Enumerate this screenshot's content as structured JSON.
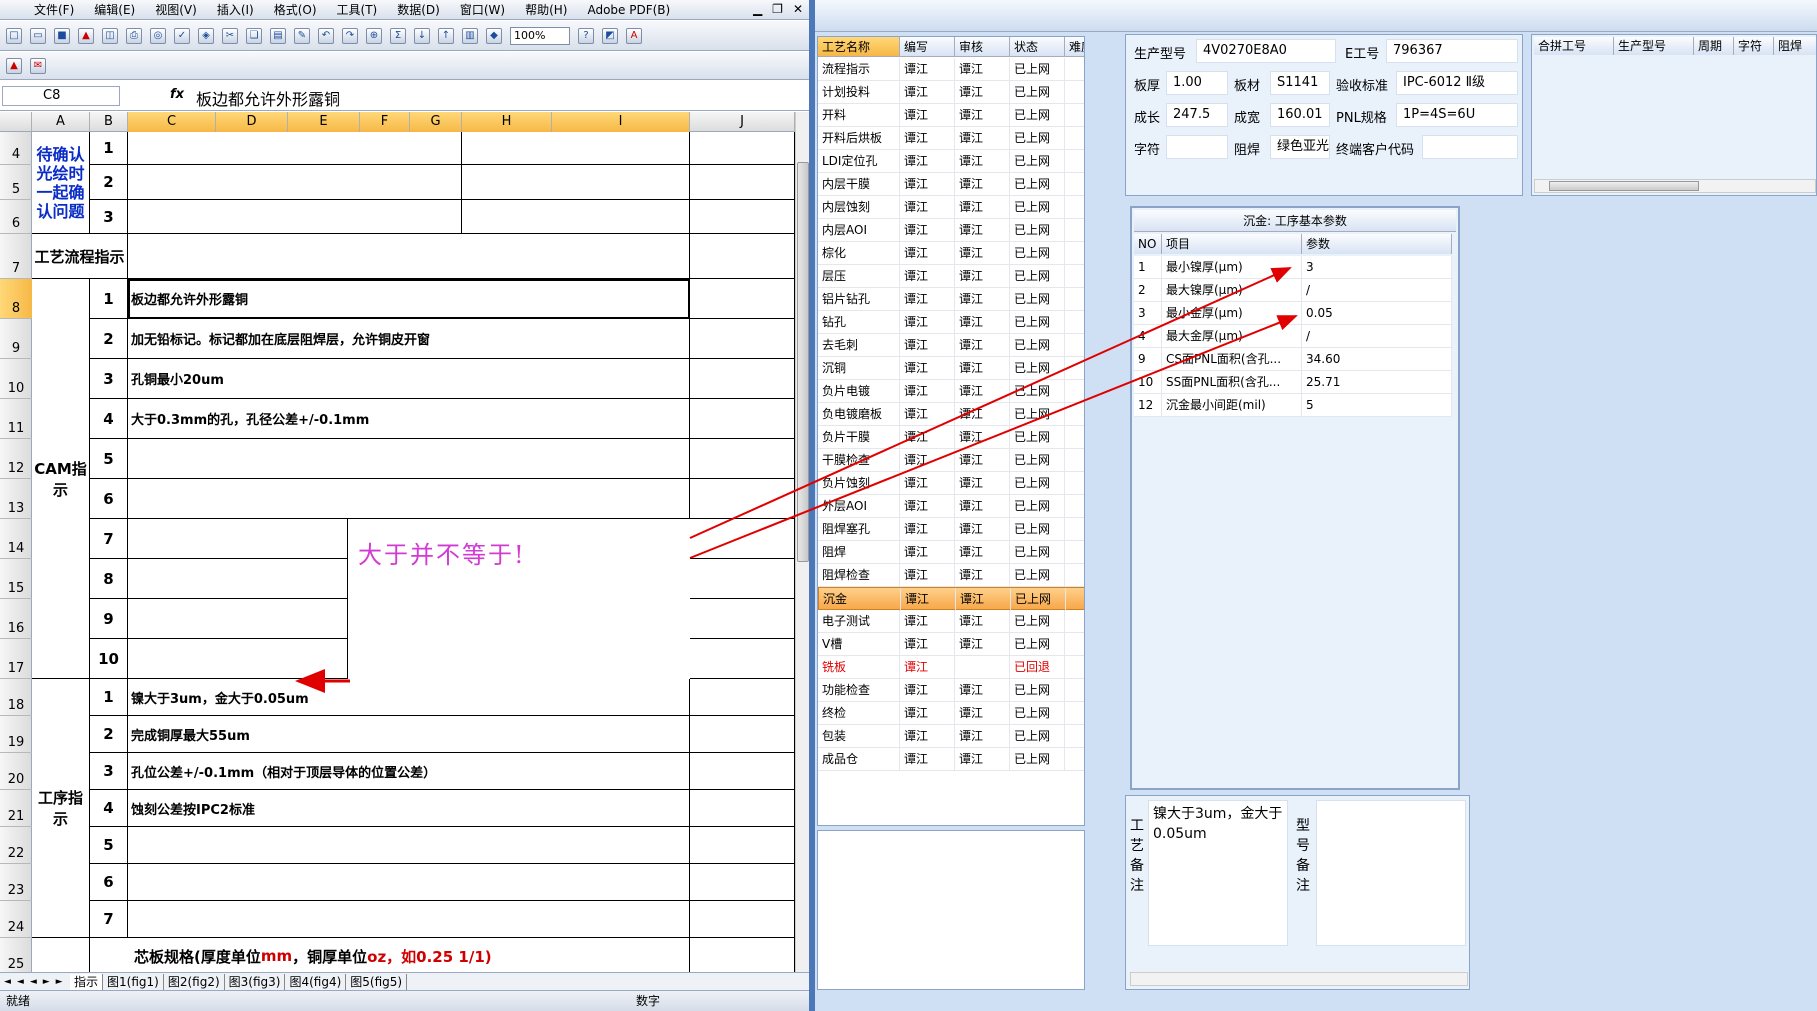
{
  "excel": {
    "menu": [
      "文件(F)",
      "编辑(E)",
      "视图(V)",
      "插入(I)",
      "格式(O)",
      "工具(T)",
      "数据(D)",
      "窗口(W)",
      "帮助(H)",
      "Adobe PDF(B)"
    ],
    "zoom": "100%",
    "name_box": "C8",
    "fx": "fx",
    "formula": "板边都允许外形露铜",
    "columns": [
      "A",
      "B",
      "C",
      "D",
      "E",
      "F",
      "G",
      "H",
      "I",
      "J"
    ],
    "rows": [
      "4",
      "5",
      "6",
      "7",
      "8",
      "9",
      "10",
      "11",
      "12",
      "13",
      "14",
      "15",
      "16",
      "17",
      "18",
      "19",
      "20",
      "21",
      "22",
      "23",
      "24",
      "25"
    ],
    "confirm_label": "待确认光绘时一起确认问题",
    "confirm_nums": [
      "1",
      "2",
      "3"
    ],
    "flow_label": "工艺流程指示",
    "cam_label": "CAM指示",
    "cam_nums": [
      "1",
      "2",
      "3",
      "4",
      "5",
      "6",
      "7",
      "8",
      "9",
      "10"
    ],
    "cam_items": [
      "板边都允许外形露铜",
      "加无铅标记。标记都加在底层阻焊层，允许铜皮开窗",
      "孔铜最小20um",
      "大于0.3mm的孔，孔径公差+/-0.1mm",
      "",
      "",
      "",
      "",
      "",
      ""
    ],
    "proc_label": "工序指示",
    "proc_nums": [
      "1",
      "2",
      "3",
      "4",
      "5",
      "6",
      "7"
    ],
    "proc_items": [
      "镍大于3um，金大于0.05um",
      "完成铜厚最大55um",
      "孔位公差+/-0.1mm（相对于顶层导体的位置公差）",
      "蚀刻公差按IPC2标准",
      "",
      "",
      ""
    ],
    "core_spec_a": "芯板规格(厚度单位",
    "core_spec_b": "mm",
    "core_spec_c": "，铜厚单位",
    "core_spec_d": "oz，如0.25 1/1)",
    "sheet_tabs": [
      "指示",
      "图1(fig1)",
      "图2(fig2)",
      "图3(fig3)",
      "图4(fig4)",
      "图5(fig5)"
    ],
    "status_ready": "就绪",
    "status_num": "数字",
    "annotation": "大于并不等于!"
  },
  "process": {
    "headers": [
      "工艺名称",
      "编写",
      "审核",
      "状态",
      "难度"
    ],
    "rows": [
      [
        "流程指示",
        "谭江",
        "谭江",
        "已上网"
      ],
      [
        "计划投料",
        "谭江",
        "谭江",
        "已上网"
      ],
      [
        "开料",
        "谭江",
        "谭江",
        "已上网"
      ],
      [
        "开料后烘板",
        "谭江",
        "谭江",
        "已上网"
      ],
      [
        "LDI定位孔",
        "谭江",
        "谭江",
        "已上网"
      ],
      [
        "内层干膜",
        "谭江",
        "谭江",
        "已上网"
      ],
      [
        "内层蚀刻",
        "谭江",
        "谭江",
        "已上网"
      ],
      [
        "内层AOI",
        "谭江",
        "谭江",
        "已上网"
      ],
      [
        "棕化",
        "谭江",
        "谭江",
        "已上网"
      ],
      [
        "层压",
        "谭江",
        "谭江",
        "已上网"
      ],
      [
        "铝片钻孔",
        "谭江",
        "谭江",
        "已上网"
      ],
      [
        "钻孔",
        "谭江",
        "谭江",
        "已上网"
      ],
      [
        "去毛刺",
        "谭江",
        "谭江",
        "已上网"
      ],
      [
        "沉铜",
        "谭江",
        "谭江",
        "已上网"
      ],
      [
        "负片电镀",
        "谭江",
        "谭江",
        "已上网"
      ],
      [
        "负电镀磨板",
        "谭江",
        "谭江",
        "已上网"
      ],
      [
        "负片干膜",
        "谭江",
        "谭江",
        "已上网"
      ],
      [
        "干膜检查",
        "谭江",
        "谭江",
        "已上网"
      ],
      [
        "负片蚀刻",
        "谭江",
        "谭江",
        "已上网"
      ],
      [
        "外层AOI",
        "谭江",
        "谭江",
        "已上网"
      ],
      [
        "阻焊塞孔",
        "谭江",
        "谭江",
        "已上网"
      ],
      [
        "阻焊",
        "谭江",
        "谭江",
        "已上网"
      ],
      [
        "阻焊检查",
        "谭江",
        "谭江",
        "已上网"
      ],
      [
        "沉金",
        "谭江",
        "谭江",
        "已上网"
      ],
      [
        "电子测试",
        "谭江",
        "谭江",
        "已上网"
      ],
      [
        "V槽",
        "谭江",
        "谭江",
        "已上网"
      ],
      [
        "铣板",
        "谭江",
        "",
        "已回退"
      ],
      [
        "功能检查",
        "谭江",
        "谭江",
        "已上网"
      ],
      [
        "终检",
        "谭江",
        "谭江",
        "已上网"
      ],
      [
        "包装",
        "谭江",
        "谭江",
        "已上网"
      ],
      [
        "成品仓",
        "谭江",
        "谭江",
        "已上网"
      ]
    ]
  },
  "info": {
    "model_label": "生产型号",
    "model": "4V0270E8A0",
    "eng_label": "E工号",
    "eng": "796367",
    "thick_label": "板厚",
    "thick": "1.00",
    "mat_label": "板材",
    "mat": "S1141",
    "std_label": "验收标准",
    "std": "IPC-6012 Ⅱ级",
    "len_label": "成长",
    "len": "247.5",
    "wid_label": "成宽",
    "wid": "160.01",
    "pnl_label": "PNL规格",
    "pnl": "1P=4S=6U",
    "char_label": "字符",
    "char": "",
    "mask_label": "阻焊",
    "mask": "绿色亚光",
    "cust_label": "终端客户代码",
    "cust": ""
  },
  "merge": {
    "headers": [
      "合拼工号",
      "生产型号",
      "周期",
      "字符",
      "阻焊"
    ]
  },
  "params": {
    "title": "沉金: 工序基本参数",
    "headers": [
      "NO",
      "项目",
      "参数"
    ],
    "rows": [
      [
        "1",
        "最小镍厚(μm)",
        "3"
      ],
      [
        "2",
        "最大镍厚(μm)",
        "/"
      ],
      [
        "3",
        "最小金厚(μm)",
        "0.05"
      ],
      [
        "4",
        "最大金厚(μm)",
        "/"
      ],
      [
        "9",
        "CS面PNL面积(含孔...",
        "34.60"
      ],
      [
        "10",
        "SS面PNL面积(含孔...",
        "25.71"
      ],
      [
        "12",
        "沉金最小间距(mil)",
        "5"
      ]
    ]
  },
  "notes": {
    "craft_label": "工艺备注",
    "craft_text": "镍大于3um，金大于0.05um",
    "model_label": "型号备注",
    "model_text": ""
  },
  "colors": {
    "annotation": "#d23bd2",
    "arrow": "#e00000",
    "selected": "#f6b846",
    "blue_text": "#0a2cc7"
  }
}
